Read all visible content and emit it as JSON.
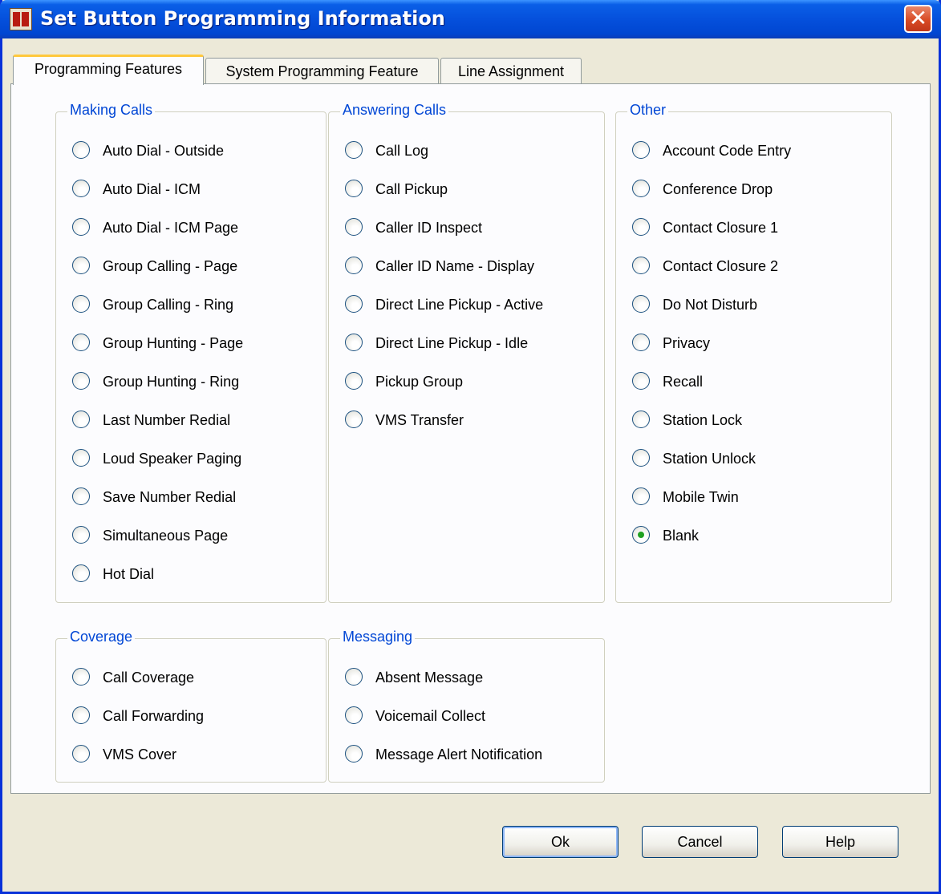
{
  "window": {
    "title": "Set Button Programming Information",
    "close_icon": "close-icon"
  },
  "tabs": [
    {
      "label": "Programming Features",
      "active": true
    },
    {
      "label": "System Programming Feature",
      "active": false
    },
    {
      "label": "Line Assignment",
      "active": false
    }
  ],
  "groups": {
    "making_calls": {
      "title": "Making Calls",
      "options": [
        "Auto Dial - Outside",
        "Auto Dial - ICM",
        "Auto Dial - ICM Page",
        "Group Calling - Page",
        "Group Calling - Ring",
        "Group Hunting - Page",
        "Group Hunting - Ring",
        "Last Number Redial",
        "Loud Speaker Paging",
        "Save Number Redial",
        "Simultaneous Page",
        "Hot Dial"
      ]
    },
    "answering_calls": {
      "title": "Answering Calls",
      "options": [
        "Call Log",
        "Call Pickup",
        "Caller ID Inspect",
        "Caller ID Name - Display",
        "Direct Line Pickup - Active",
        "Direct Line Pickup - Idle",
        "Pickup Group",
        "VMS Transfer"
      ]
    },
    "other": {
      "title": "Other",
      "options": [
        "Account Code Entry",
        "Conference Drop",
        "Contact Closure 1",
        "Contact Closure 2",
        "Do Not Disturb",
        "Privacy",
        "Recall",
        "Station Lock",
        "Station Unlock",
        "Mobile Twin",
        "Blank"
      ]
    },
    "coverage": {
      "title": "Coverage",
      "options": [
        "Call Coverage",
        "Call Forwarding",
        "VMS Cover"
      ]
    },
    "messaging": {
      "title": "Messaging",
      "options": [
        "Absent Message",
        "Voicemail Collect",
        "Message Alert Notification"
      ]
    }
  },
  "selected": "Blank",
  "buttons": {
    "ok": "Ok",
    "cancel": "Cancel",
    "help": "Help"
  },
  "colors": {
    "title_bar": "#0550dc",
    "group_title": "#0046d5",
    "selected_radio": "#21a121",
    "active_tab_accent": "#ffc83c"
  }
}
